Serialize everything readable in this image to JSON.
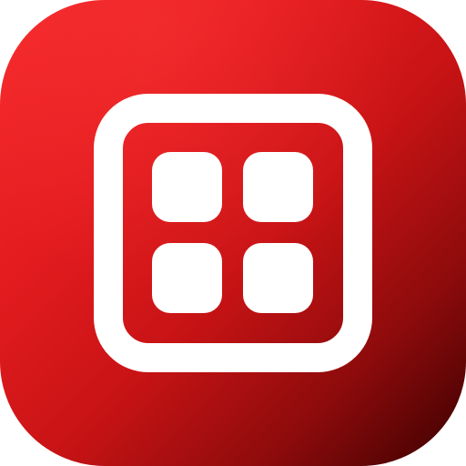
{
  "icon": {
    "name": "grid-app-icon",
    "symbol": "four-squares-in-rounded-frame",
    "colors": {
      "background_top_left": "#f5292b",
      "background_mid": "#c81315",
      "background_bottom_right": "#3a0000",
      "glyph": "#ffffff"
    }
  }
}
